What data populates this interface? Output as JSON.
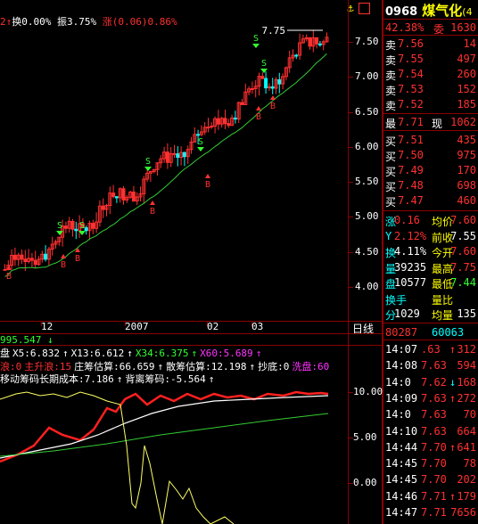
{
  "colors": {
    "bg": "#000000",
    "up": "#ff3030",
    "down": "#00ffff",
    "ma": "#33cc33",
    "yellow": "#ffff00",
    "white": "#ffffff",
    "magenta": "#ff33ff",
    "green": "#33ff33",
    "grid": "#8b0000"
  },
  "main": {
    "info_bar": {
      "prefix": "2",
      "turnover_label": "换",
      "turnover": "0.00%",
      "amplitude_label": "振",
      "amplitude": "3.75%",
      "change_label": "涨",
      "change": "(0.06)",
      "change_pct": "0.86%"
    },
    "price_labels": [
      "7.50",
      "7.00",
      "6.50",
      "6.00",
      "5.50",
      "5.00",
      "4.50",
      "4.00"
    ],
    "high_marker": "7.75",
    "x_labels": [
      "12",
      "2007",
      "02",
      "03"
    ],
    "day_line_label": "日线",
    "buy_marker": "B",
    "sell_marker": "S",
    "toolbar_icons": [
      "anchor-icon",
      "grid-icon"
    ]
  },
  "indicator": {
    "line1": {
      "value": "995.547",
      "arrow": "↓"
    },
    "line2": [
      {
        "text": "盘",
        "color": "#ffffff"
      },
      {
        "text": "X5:6.832",
        "color": "#ffffff",
        "arrow": "↑"
      },
      {
        "text": "X13:6.612",
        "color": "#ffffff",
        "arrow": "↑"
      },
      {
        "text": "X34:6.375",
        "color": "#33ff33",
        "arrow": "↑"
      },
      {
        "text": "X60:5.689",
        "color": "#ff33ff",
        "arrow": "↑"
      }
    ],
    "line3": [
      {
        "text": "浪:0",
        "color": "#ff3030"
      },
      {
        "text": "主升浪:15",
        "color": "#ff3030"
      },
      {
        "text": "庄筹估算:66.659",
        "color": "#ffffff",
        "arrow": "↑"
      },
      {
        "text": "散筹估算:12.198",
        "color": "#ffffff",
        "arrow": "↑"
      },
      {
        "text": "抄底:0",
        "color": "#ffffff"
      },
      {
        "text": "洗盘:60",
        "color": "#ff33ff"
      }
    ],
    "line4": [
      {
        "text": "移动筹码长期成本:7.186",
        "color": "#ffffff",
        "arrow": "↑"
      },
      {
        "text": "背离筹码:-5.564",
        "color": "#ffffff",
        "arrow": "↑"
      }
    ],
    "y_labels": [
      "10.00",
      "5.00",
      "0.00"
    ]
  },
  "quote": {
    "code": "0968",
    "name": "煤气化",
    "name_suffix": "(4",
    "weibi": "42.38%",
    "weicha_label": "委",
    "weicha": "1630",
    "asks": [
      {
        "label": "卖",
        "price": "7.56",
        "vol": "14"
      },
      {
        "label": "卖",
        "price": "7.55",
        "vol": "497"
      },
      {
        "label": "卖",
        "price": "7.54",
        "vol": "260"
      },
      {
        "label": "卖",
        "price": "7.53",
        "vol": "152"
      },
      {
        "label": "卖",
        "price": "7.52",
        "vol": "185"
      }
    ],
    "last": {
      "label": "最",
      "price": "7.71",
      "now_label": "现",
      "now": "1062"
    },
    "bids": [
      {
        "label": "买",
        "price": "7.51",
        "vol": "435"
      },
      {
        "label": "买",
        "price": "7.50",
        "vol": "975"
      },
      {
        "label": "买",
        "price": "7.49",
        "vol": "170"
      },
      {
        "label": "买",
        "price": "7.48",
        "vol": "698"
      },
      {
        "label": "买",
        "price": "7.47",
        "vol": "460"
      }
    ],
    "stats": [
      {
        "l": "涨",
        "v1": "0.16",
        "l2": "均价",
        "v2": "7.60",
        "c1": "#ff3030",
        "c2": "#ff3030"
      },
      {
        "l": "Y",
        "v1": "2.12%",
        "l2": "前收",
        "v2": "7.55",
        "c1": "#ff3030",
        "c2": "#ffffff"
      },
      {
        "l": "换",
        "v1": "4.11%",
        "l2": "今开",
        "v2": "7.60",
        "c1": "#ffffff",
        "c2": "#ff3030"
      },
      {
        "l": "量",
        "v1": "39235",
        "l2": "最高",
        "v2": "7.75",
        "c1": "#ffffff",
        "c2": "#ff3030"
      },
      {
        "l": "盘",
        "v1": "10577",
        "l2": "最低",
        "v2": "7.44",
        "c1": "#ffffff",
        "c2": "#33ff33"
      },
      {
        "l": "换手",
        "v1": "",
        "l2": "量比",
        "v2": "",
        "c1": "#ffffff",
        "c2": "#ffffff"
      },
      {
        "l": "分",
        "v1": "1029",
        "l2": "均量",
        "v2": "135",
        "c1": "#ffffff",
        "c2": "#ffffff"
      }
    ],
    "index_left": "80287",
    "index_right": "60063",
    "ticks": [
      {
        "time": "14:07",
        "price": ".63",
        "flag": "↑",
        "vol": "312"
      },
      {
        "time": "14:08",
        "price": "7.63",
        "flag": "",
        "vol": "594"
      },
      {
        "time": "14:0",
        "price": "7.62",
        "flag": "↓",
        "vol": "168"
      },
      {
        "time": "14:09",
        "price": "7.63",
        "flag": "↑",
        "vol": "272"
      },
      {
        "time": "14:0",
        "price": "7.63",
        "flag": "",
        "vol": "70"
      },
      {
        "time": "14:10",
        "price": "7.63",
        "flag": "",
        "vol": "664"
      },
      {
        "time": "14:44",
        "price": "7.70",
        "flag": "↑",
        "vol": "641"
      },
      {
        "time": "14:45",
        "price": "7.70",
        "flag": "",
        "vol": "78"
      },
      {
        "time": "14:45",
        "price": "7.70",
        "flag": "",
        "vol": "202"
      },
      {
        "time": "14:46",
        "price": "7.71",
        "flag": "↑",
        "vol": "179"
      },
      {
        "time": "14:47",
        "price": "7.71",
        "flag": "",
        "vol": "7656"
      }
    ]
  }
}
